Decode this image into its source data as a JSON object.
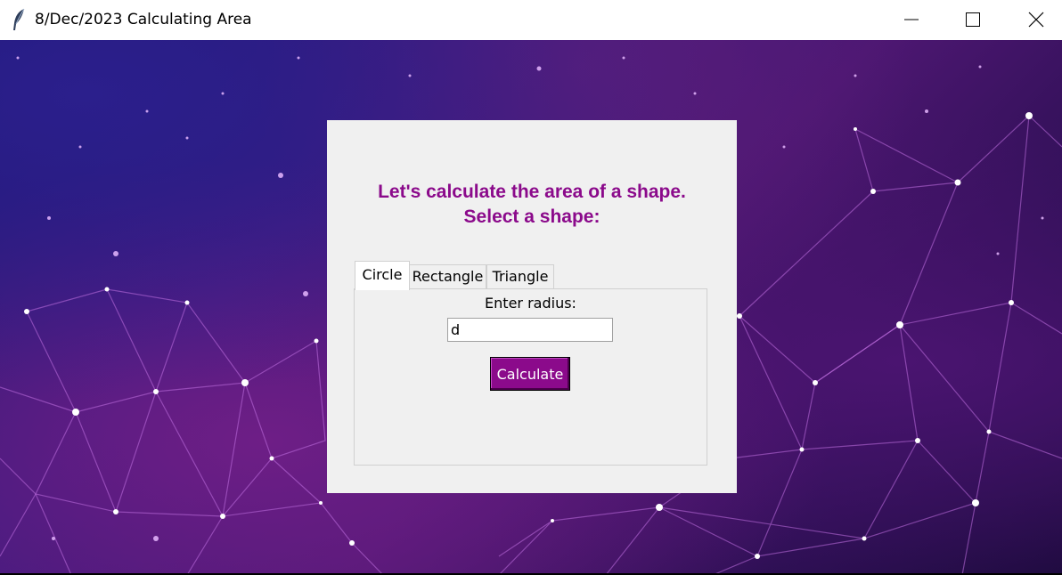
{
  "window": {
    "title": "8/Dec/2023 Calculating Area",
    "icon": "feather-icon",
    "controls": [
      "minimize-icon",
      "maximize-icon",
      "close-icon"
    ]
  },
  "panel": {
    "heading_line1": "Let's calculate the area of a shape.",
    "heading_line2": "Select a shape:",
    "heading_color": "#8b0a8b"
  },
  "tabs": [
    {
      "label": "Circle",
      "selected": true
    },
    {
      "label": "Rectangle",
      "selected": false
    },
    {
      "label": "Triangle",
      "selected": false
    }
  ],
  "circle_tab": {
    "prompt": "Enter radius:",
    "radius_value": "d",
    "button_label": "Calculate",
    "button_color": "#8b0a8b"
  }
}
